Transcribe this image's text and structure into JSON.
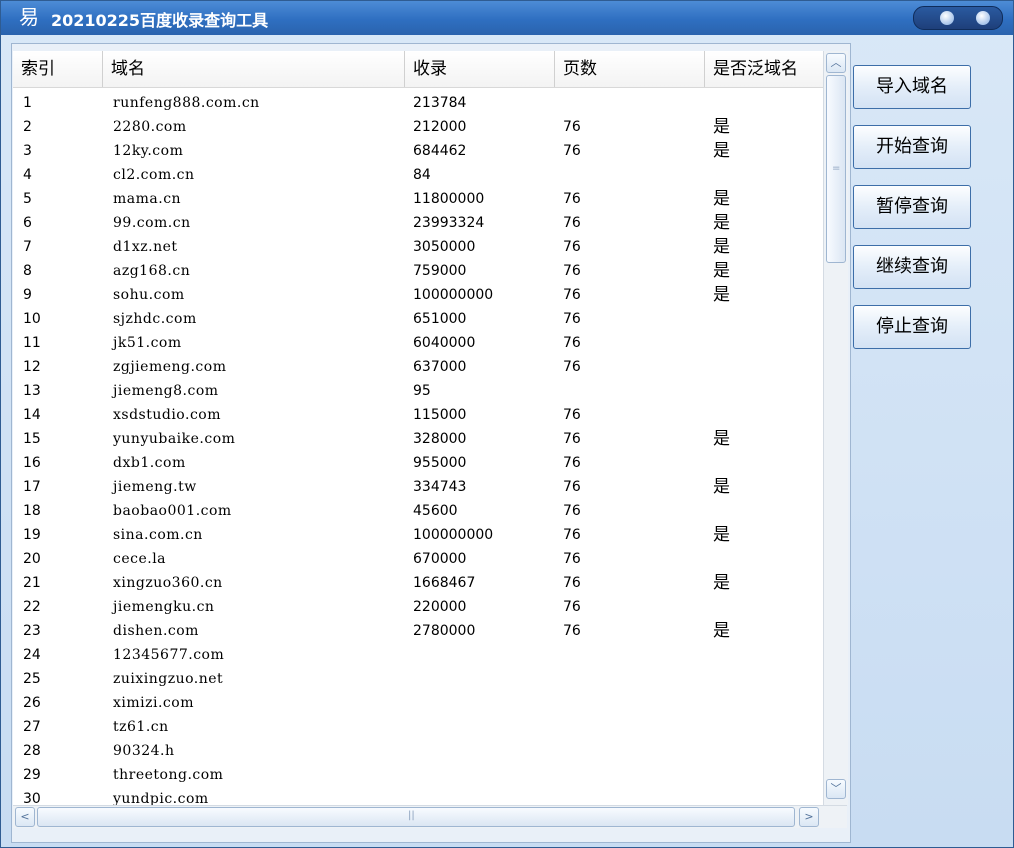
{
  "window": {
    "title": "20210225百度收录查询工具"
  },
  "icons": {
    "app": "yi-app-icon",
    "controls": "window-control-dots"
  },
  "table": {
    "columns": [
      "索引",
      "域名",
      "收录",
      "页数",
      "是否泛域名"
    ],
    "rows": [
      [
        "1",
        "runfeng888.com.cn",
        "213784",
        "",
        ""
      ],
      [
        "2",
        "2280.com",
        "212000",
        "76",
        "是"
      ],
      [
        "3",
        "12ky.com",
        "684462",
        "76",
        "是"
      ],
      [
        "4",
        "cl2.com.cn",
        "84",
        "",
        ""
      ],
      [
        "5",
        "mama.cn",
        "11800000",
        "76",
        "是"
      ],
      [
        "6",
        "99.com.cn",
        "23993324",
        "76",
        "是"
      ],
      [
        "7",
        "d1xz.net",
        "3050000",
        "76",
        "是"
      ],
      [
        "8",
        "azg168.cn",
        "759000",
        "76",
        "是"
      ],
      [
        "9",
        "sohu.com",
        "100000000",
        "76",
        "是"
      ],
      [
        "10",
        "sjzhdc.com",
        "651000",
        "76",
        ""
      ],
      [
        "11",
        "jk51.com",
        "6040000",
        "76",
        ""
      ],
      [
        "12",
        "zgjiemeng.com",
        "637000",
        "76",
        ""
      ],
      [
        "13",
        "jiemeng8.com",
        "95",
        "",
        ""
      ],
      [
        "14",
        "xsdstudio.com",
        "115000",
        "76",
        ""
      ],
      [
        "15",
        "yunyubaike.com",
        "328000",
        "76",
        "是"
      ],
      [
        "16",
        "dxb1.com",
        "955000",
        "76",
        ""
      ],
      [
        "17",
        "jiemeng.tw",
        "334743",
        "76",
        "是"
      ],
      [
        "18",
        "baobao001.com",
        "45600",
        "76",
        ""
      ],
      [
        "19",
        "sina.com.cn",
        "100000000",
        "76",
        "是"
      ],
      [
        "20",
        "cece.la",
        "670000",
        "76",
        ""
      ],
      [
        "21",
        "xingzuo360.cn",
        "1668467",
        "76",
        "是"
      ],
      [
        "22",
        "jiemengku.cn",
        "220000",
        "76",
        ""
      ],
      [
        "23",
        "dishen.com",
        "2780000",
        "76",
        "是"
      ],
      [
        "24",
        "12345677.com",
        "",
        "",
        ""
      ],
      [
        "25",
        "zuixingzuo.net",
        "",
        "",
        ""
      ],
      [
        "26",
        "ximizi.com",
        "",
        "",
        ""
      ],
      [
        "27",
        "tz61.cn",
        "",
        "",
        ""
      ],
      [
        "28",
        "90324.h",
        "",
        "",
        ""
      ],
      [
        "29",
        "threetong.com",
        "",
        "",
        ""
      ],
      [
        "30",
        "yundpic.com",
        "",
        "",
        ""
      ]
    ]
  },
  "buttons": {
    "import": "导入域名",
    "start": "开始查询",
    "pause": "暂停查询",
    "resume": "继续查询",
    "stop": "停止查询"
  }
}
